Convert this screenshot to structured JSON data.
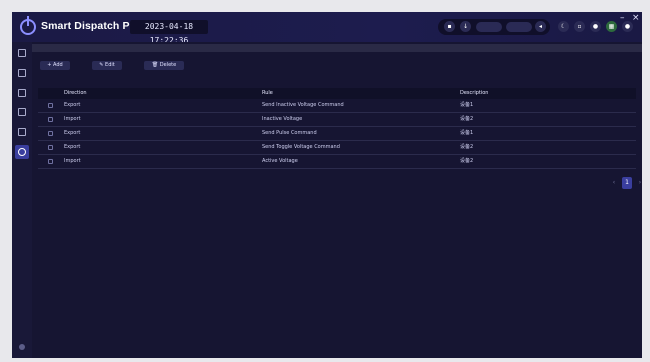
{
  "header": {
    "app_title": "Smart Dispatch Plus",
    "datetime": "2023-04-18 17:22:36",
    "pills": [
      "",
      ""
    ],
    "window": {
      "minimize": "–",
      "close": "×"
    }
  },
  "toolbar": {
    "add_label": "+ Add",
    "edit_label": "✎ Edit",
    "delete_label": "🗑 Delete"
  },
  "table": {
    "columns": [
      "Direction",
      "Rule",
      "Description"
    ],
    "rows": [
      {
        "direction": "Export",
        "rule": "Send Inactive Voltage Command",
        "description": "设备1"
      },
      {
        "direction": "Import",
        "rule": "Inactive Voltage",
        "description": "设备2"
      },
      {
        "direction": "Export",
        "rule": "Send Pulse Command",
        "description": "设备1"
      },
      {
        "direction": "Export",
        "rule": "Send Toggle Voltage Command",
        "description": "设备2"
      },
      {
        "direction": "Import",
        "rule": "Active Voltage",
        "description": "设备2"
      }
    ]
  },
  "pagination": {
    "current_page": "1",
    "prev": "‹",
    "next": "›"
  },
  "colors": {
    "accent": "#3a3e9e",
    "background": "#14132a",
    "header": "#1d1c4e"
  }
}
